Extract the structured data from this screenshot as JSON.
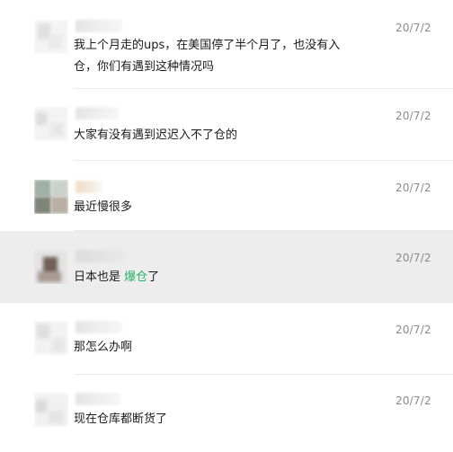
{
  "messages": [
    {
      "time": "20/7/2",
      "lines": [
        "我上个月走的ups，在美国停了半个月了，也没有入",
        "仓，你们有遇到这种情况吗"
      ]
    },
    {
      "time": "20/7/2",
      "text": "大家有没有遇到迟迟入不了仓的"
    },
    {
      "time": "20/7/2",
      "text": "最近慢很多"
    },
    {
      "time": "20/7/2",
      "text_before": "日本也是 ",
      "text_highlight": "爆仓",
      "text_after": "了",
      "highlight_color": "#2aae67",
      "highlighted": true
    },
    {
      "time": "20/7/2",
      "text": "那怎么办啊"
    },
    {
      "time": "20/7/2",
      "text": "现在仓库都断货了"
    }
  ],
  "colors": {
    "background": "#ffffff",
    "hover_row": "#ededed",
    "keyword_highlight": "#2aae67",
    "time_text": "#8a8a8a",
    "divider": "#ebebeb"
  }
}
